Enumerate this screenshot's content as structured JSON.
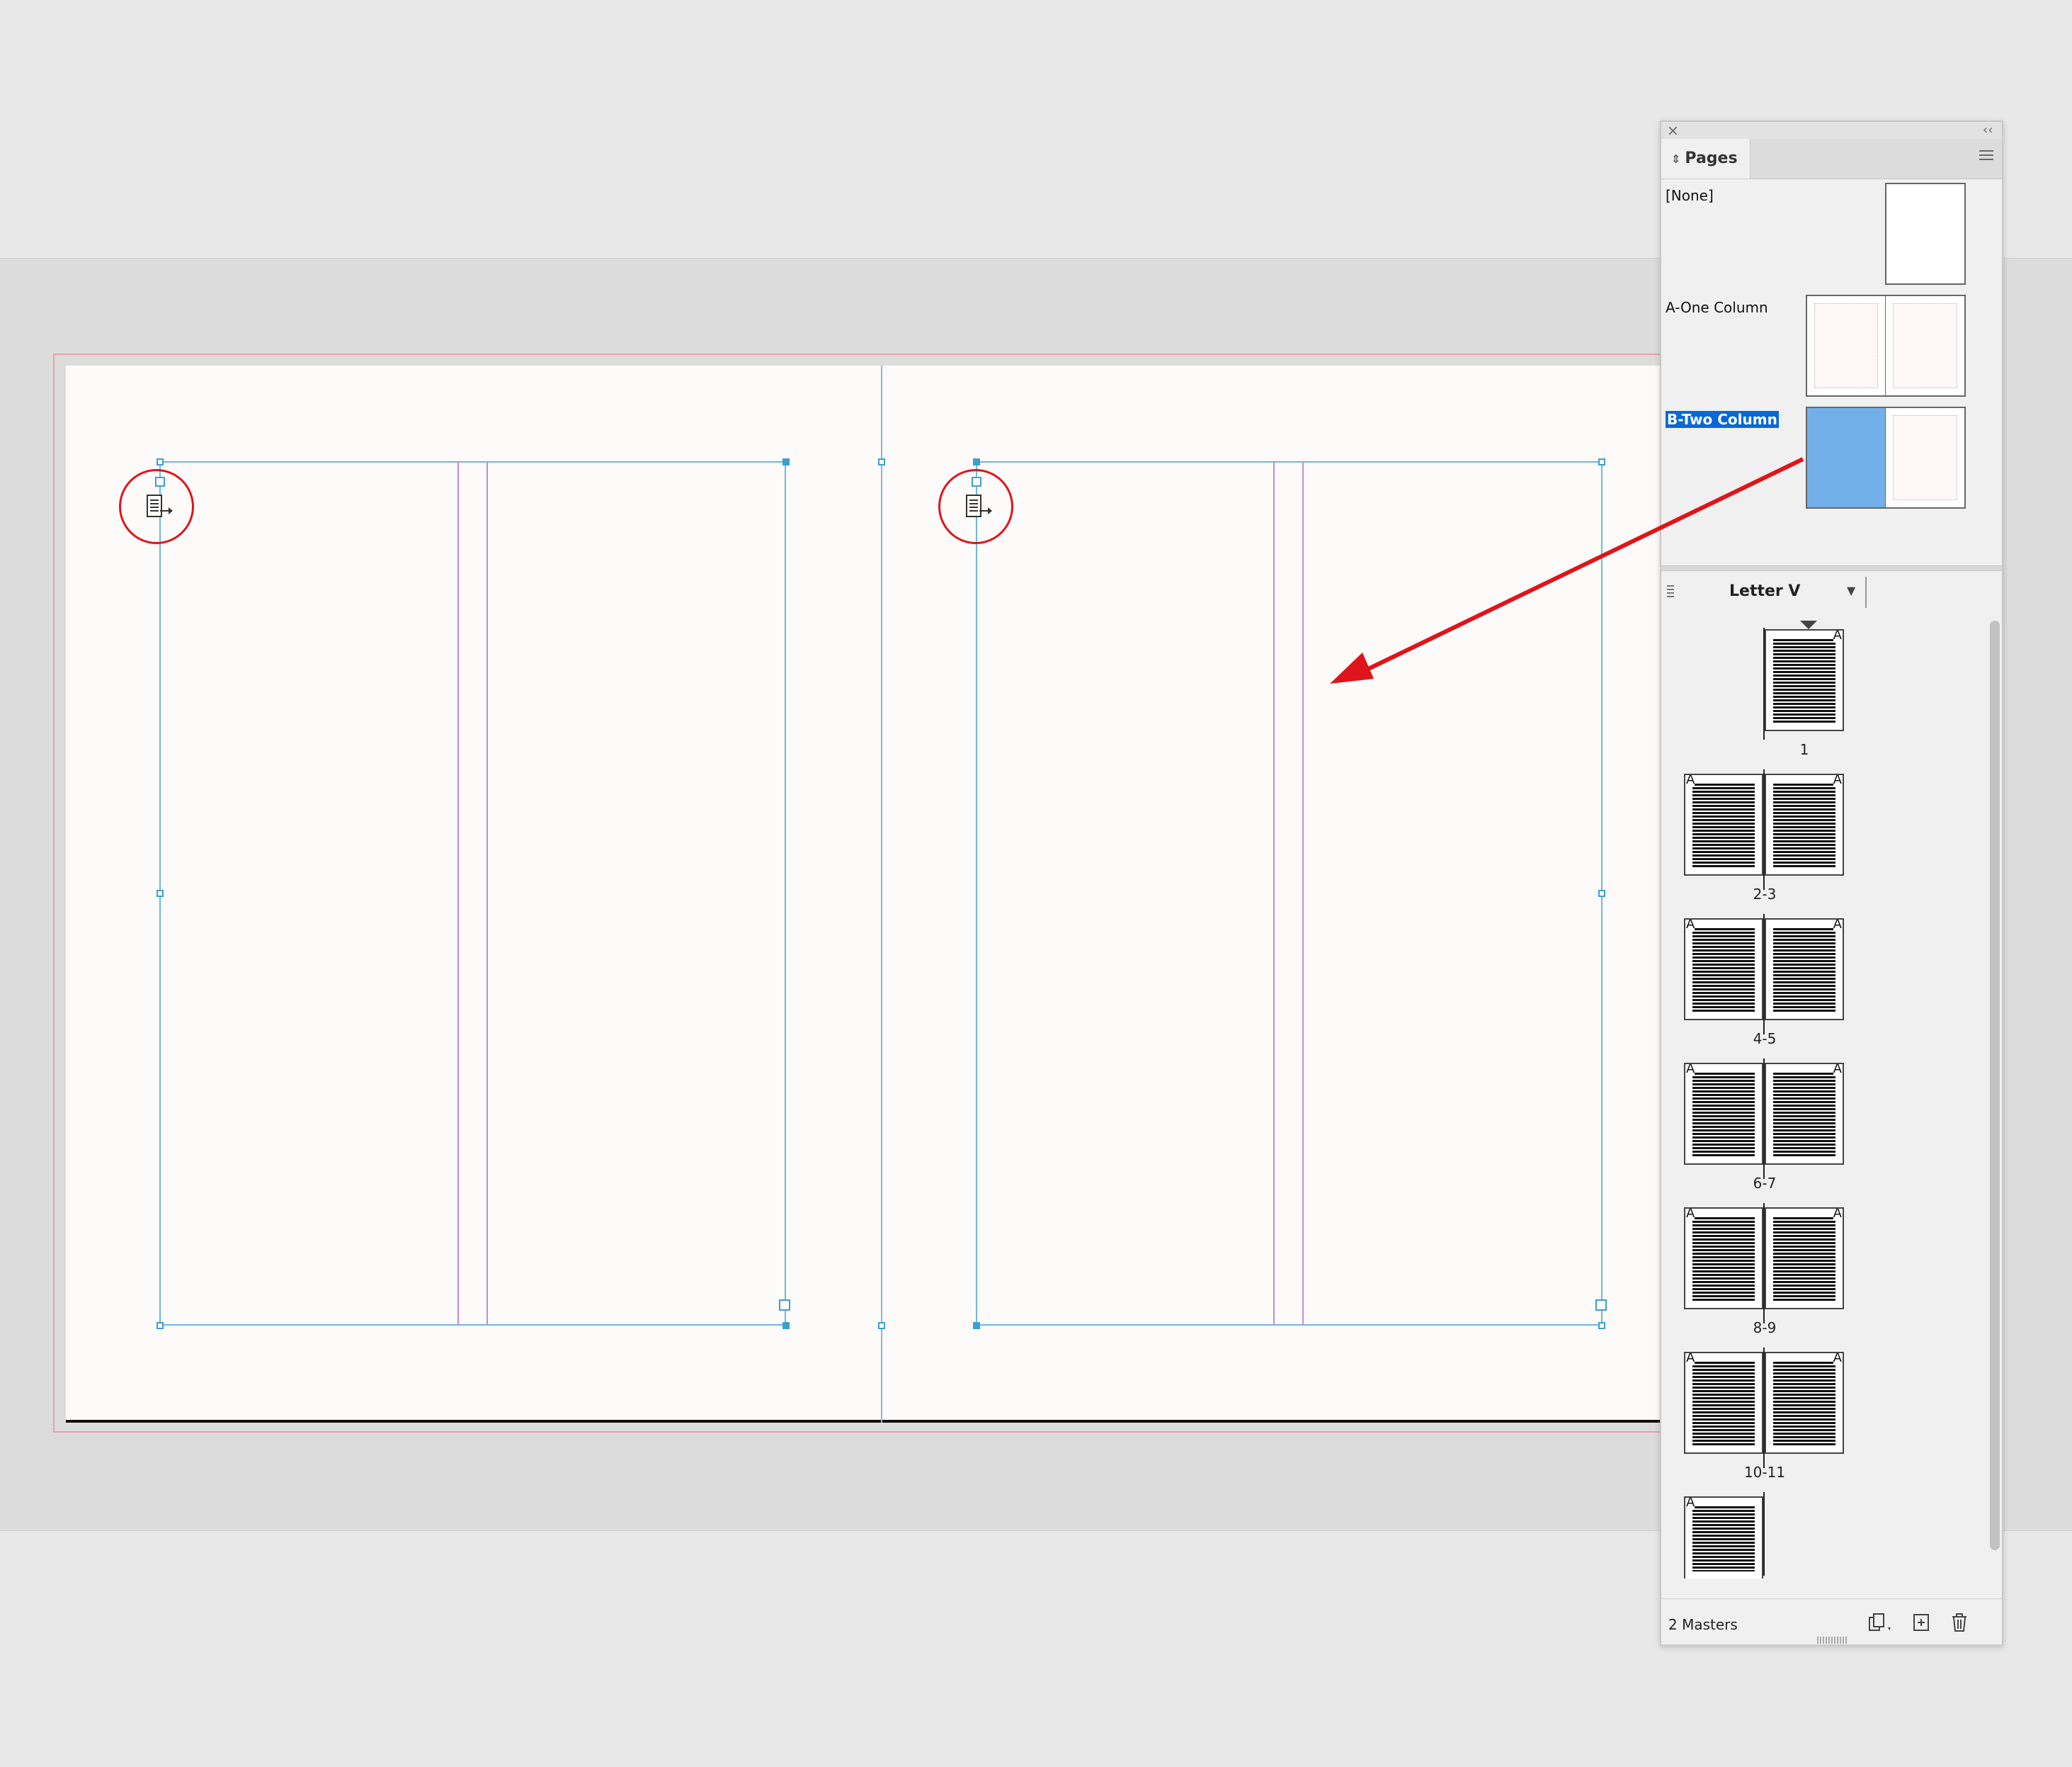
{
  "pages_panel": {
    "tab_label": "Pages",
    "masters": [
      {
        "name": "[None]"
      },
      {
        "name": "A-One Column"
      },
      {
        "name": "B-Two Column",
        "selected": true
      }
    ],
    "page_size": "Letter V",
    "pages": [
      {
        "label": "1",
        "master": "A"
      },
      {
        "label": "2-3",
        "master": "A"
      },
      {
        "label": "4-5",
        "master": "A"
      },
      {
        "label": "6-7",
        "master": "A"
      },
      {
        "label": "8-9",
        "master": "A"
      },
      {
        "label": "10-11",
        "master": "A"
      },
      {
        "label": "",
        "master": "A"
      }
    ],
    "footer_status": "2 Masters",
    "icons": {
      "close": "close-icon",
      "collapse": "double-chevron-left-icon",
      "menu": "hamburger-menu-icon",
      "edit_page_size": "edit-page-size-icon",
      "new_page": "new-page-icon",
      "delete": "trash-icon"
    }
  },
  "colors": {
    "frame_edge": "#6fb8dd",
    "column_guide": "#c48ad8",
    "bleed": "#e8a0b0",
    "annotation": "#e0141b",
    "selection": "#0b67d6",
    "selected_thumb": "#73b0ea"
  }
}
